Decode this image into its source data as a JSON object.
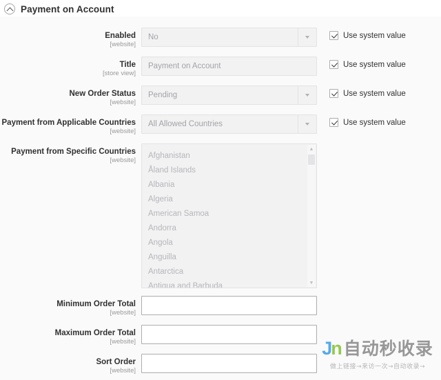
{
  "section": {
    "title": "Payment on Account",
    "collapse_icon": "chevron-up-circle-icon"
  },
  "fields": [
    {
      "label": "Enabled",
      "scope": "[website]",
      "type": "select",
      "value": "No",
      "disabled": true,
      "use_system_value": true
    },
    {
      "label": "Title",
      "scope": "[store view]",
      "type": "text",
      "value": "Payment on Account",
      "disabled": true,
      "use_system_value": true
    },
    {
      "label": "New Order Status",
      "scope": "[website]",
      "type": "select",
      "value": "Pending",
      "disabled": true,
      "use_system_value": true
    },
    {
      "label": "Payment from Applicable Countries",
      "scope": "[website]",
      "type": "select",
      "value": "All Allowed Countries",
      "disabled": true,
      "use_system_value": true
    },
    {
      "label": "Payment from Specific Countries",
      "scope": "[website]",
      "type": "multiselect",
      "disabled": true,
      "use_system_value": false,
      "options": [
        "Afghanistan",
        "Åland Islands",
        "Albania",
        "Algeria",
        "American Samoa",
        "Andorra",
        "Angola",
        "Anguilla",
        "Antarctica",
        "Antigua and Barbuda"
      ]
    },
    {
      "label": "Minimum Order Total",
      "scope": "[website]",
      "type": "text",
      "value": "",
      "disabled": false,
      "use_system_value": false
    },
    {
      "label": "Maximum Order Total",
      "scope": "[website]",
      "type": "text",
      "value": "",
      "disabled": false,
      "use_system_value": false
    },
    {
      "label": "Sort Order",
      "scope": "[website]",
      "type": "text",
      "value": "",
      "disabled": false,
      "use_system_value": false
    }
  ],
  "use_system_value_label": "Use system value",
  "scrollbar": {
    "up_arrow": "scroll-up-arrow-icon",
    "down_arrow": "scroll-down-arrow-icon"
  },
  "watermark": {
    "logo_j": "J",
    "logo_n": "n",
    "text": "自动秒收录",
    "tagline": "做上链接→来访一次→自动收录→"
  },
  "colors": {
    "page_background": "#fafafa",
    "header_background": "#ffffff",
    "label_text": "#303030",
    "scope_text": "#999999",
    "disabled_field_background": "#f2f2f3",
    "disabled_field_text": "#a3a3a8",
    "enabled_field_border": "#adadad",
    "watermark_blue": "#4aa3e8",
    "watermark_green": "#8cc63f"
  }
}
